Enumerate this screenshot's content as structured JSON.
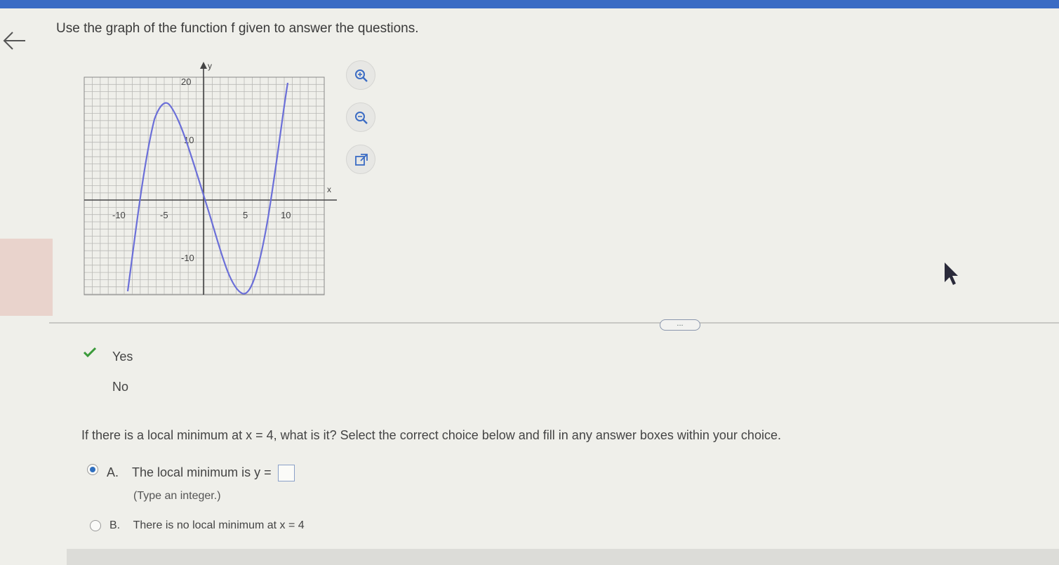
{
  "header": {
    "title": "Use the graph of the function f given to answer the questions."
  },
  "graph": {
    "x_axis_label": "x",
    "y_axis_label": "y",
    "tick_labels": {
      "y_top": "20",
      "y_mid": "10",
      "y_neg": "-10",
      "x_neg10": "-10",
      "x_neg5": "-5",
      "x_5": "5",
      "x_10": "10"
    }
  },
  "tools": [
    "zoom-in-icon",
    "zoom-out-icon",
    "external-link-icon"
  ],
  "more_label": "...",
  "prev_question": {
    "options": [
      {
        "label": "Yes",
        "selected": true
      },
      {
        "label": "No",
        "selected": false
      }
    ]
  },
  "question": {
    "text": "If there is a local minimum at x = 4, what is it? Select the correct choice below and fill in any answer boxes within your choice.",
    "choice_a_letter": "A.",
    "choice_a_text": "The local minimum is y =",
    "choice_a_hint": "(Type an integer.)",
    "choice_b_letter": "B.",
    "choice_b_text": "There is no local minimum at x = 4"
  },
  "colors": {
    "accent": "#3b6cc4",
    "curve": "#6b6fd8",
    "check": "#3a9a3a"
  }
}
